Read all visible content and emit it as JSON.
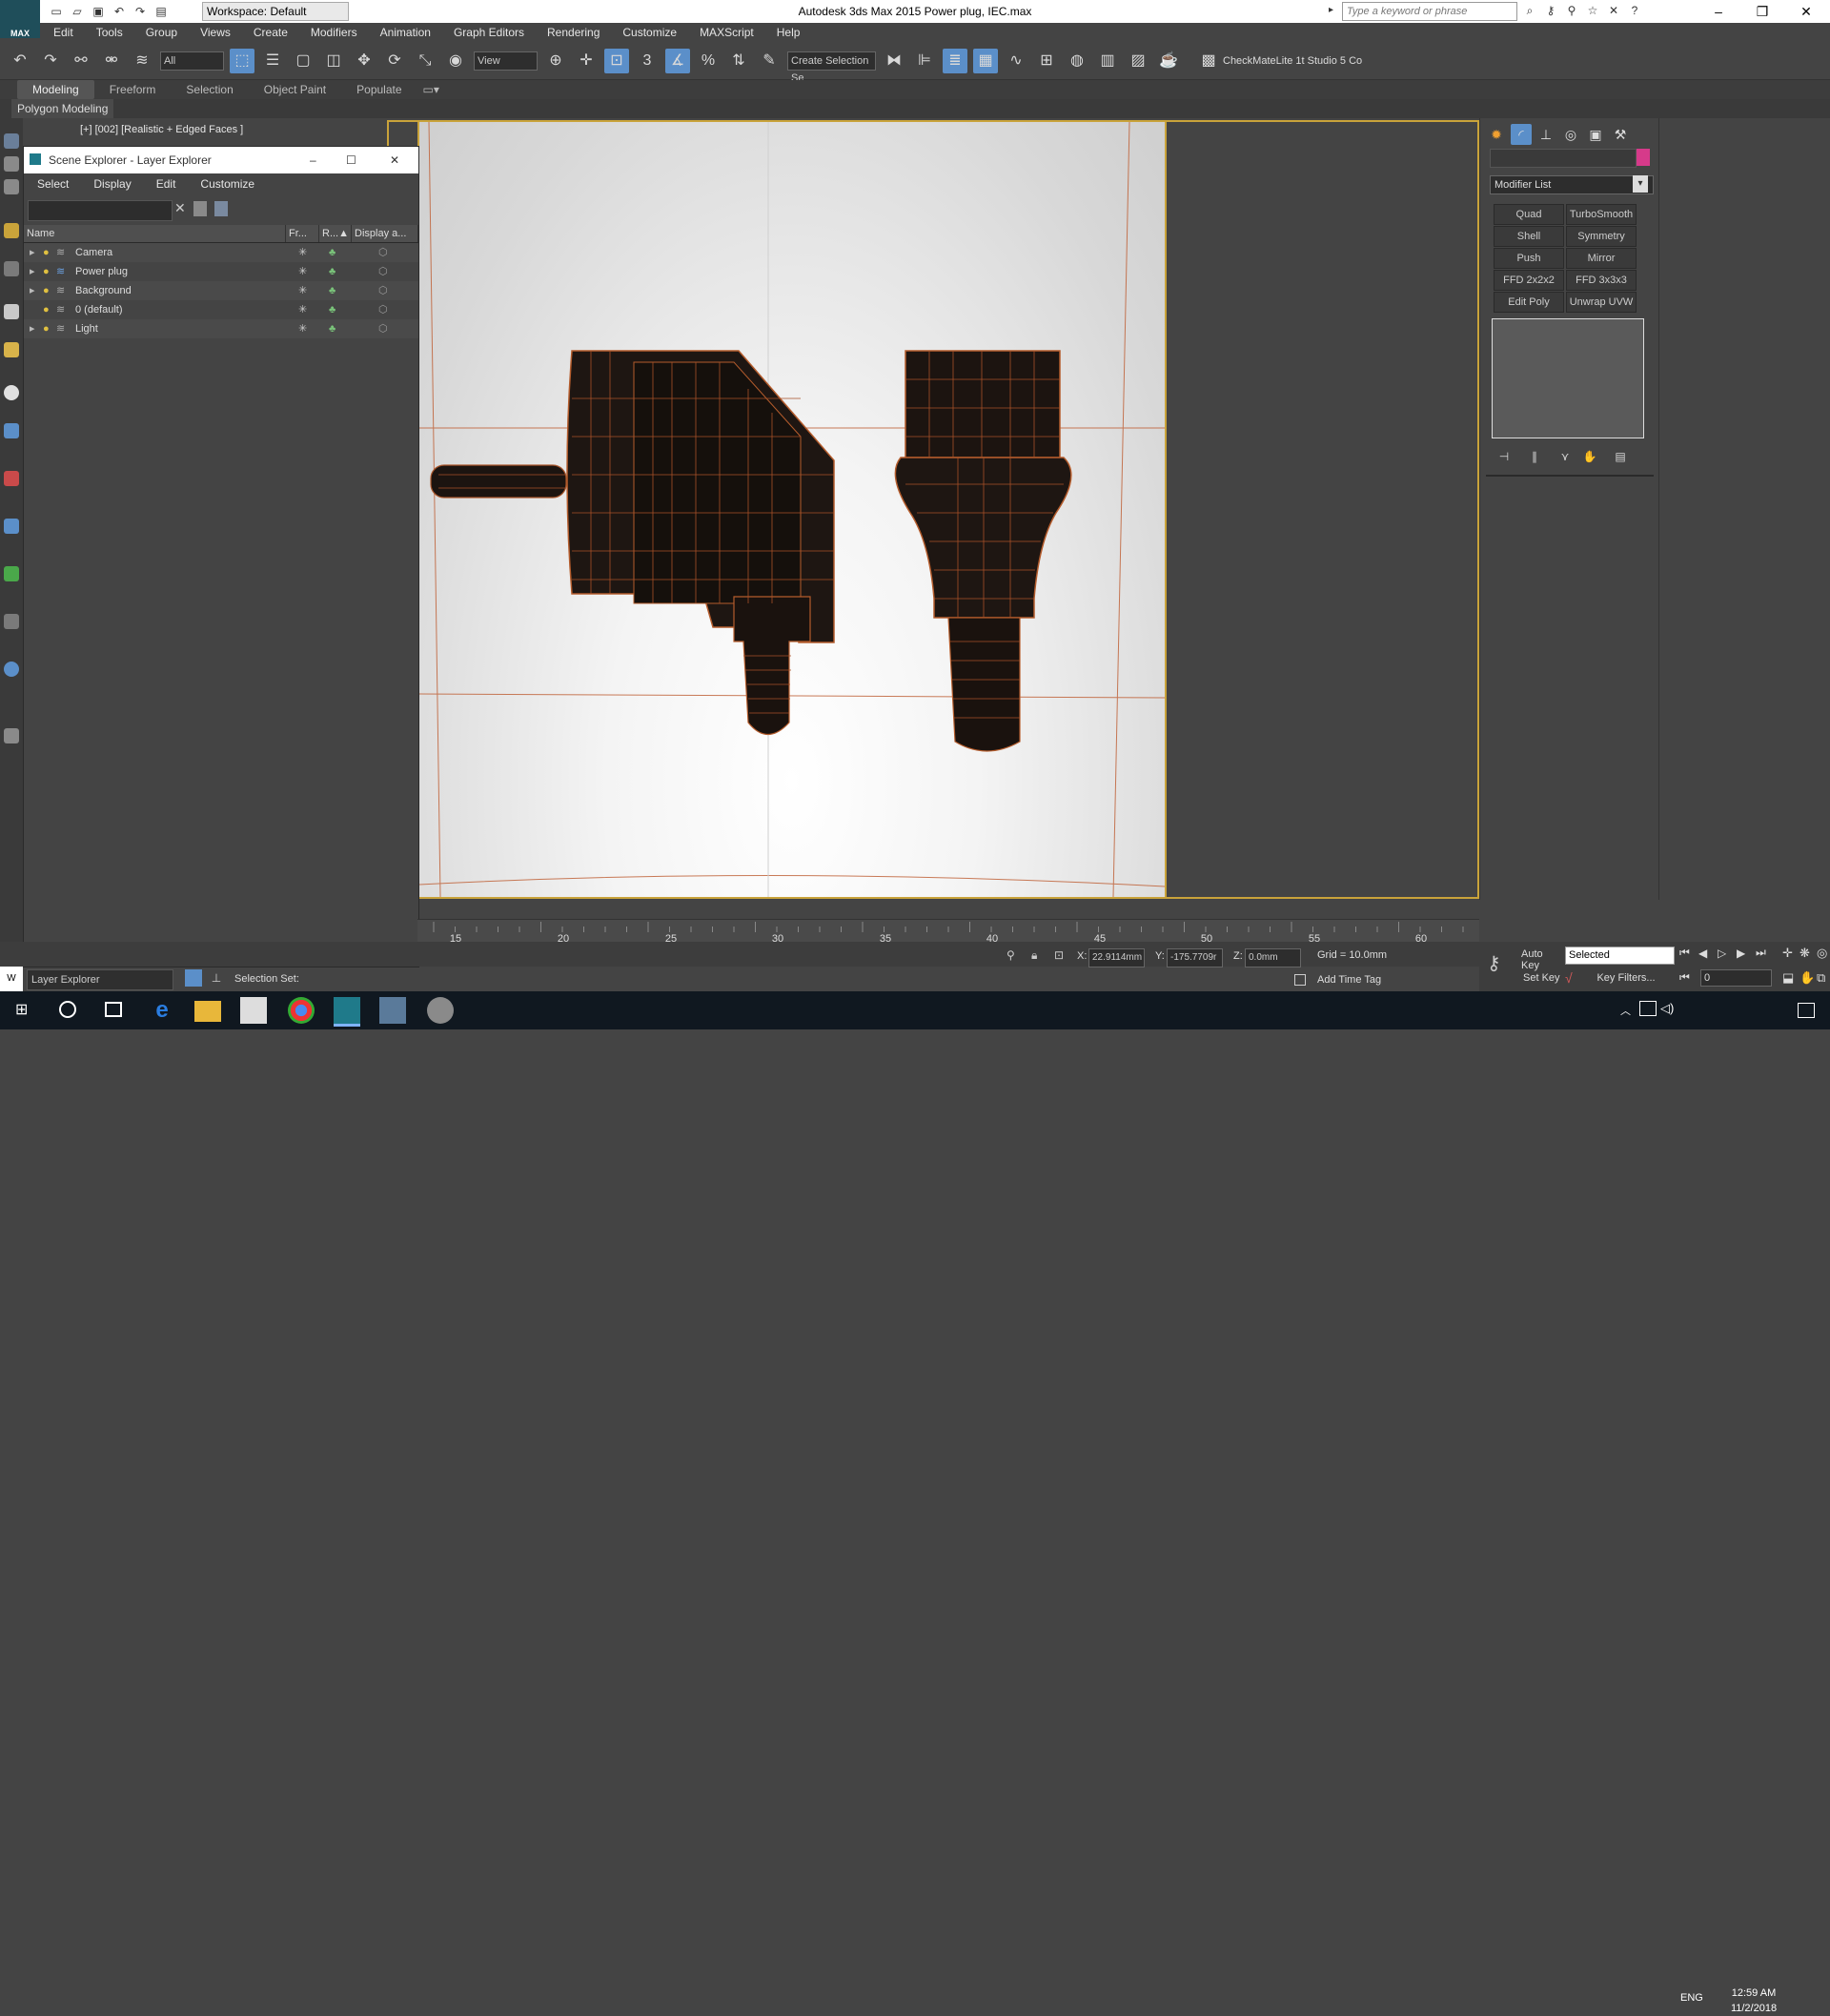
{
  "titlebar": {
    "app_title": "Autodesk 3ds Max  2015      Power plug, IEC.max",
    "workspace": "Workspace: Default",
    "search_placeholder": "Type a keyword or phrase",
    "logo": "MAX"
  },
  "menubar": [
    "Edit",
    "Tools",
    "Group",
    "Views",
    "Create",
    "Modifiers",
    "Animation",
    "Graph Editors",
    "Rendering",
    "Customize",
    "MAXScript",
    "Help"
  ],
  "toolbar": {
    "selection_filter": "All",
    "ref_coord": "View",
    "named_selection": "Create Selection Se",
    "snap_label": "3",
    "plugin_label": "CheckMateLite 1t Studio 5 Co"
  },
  "ribbon": {
    "tabs": [
      "Modeling",
      "Freeform",
      "Selection",
      "Object Paint",
      "Populate"
    ],
    "active_tab": "Modeling",
    "panel_label": "Polygon Modeling"
  },
  "viewport": {
    "label": "[+] [002] [Realistic + Edged Faces ]"
  },
  "scene_explorer": {
    "title": "Scene Explorer - Layer Explorer",
    "menu": [
      "Select",
      "Display",
      "Edit",
      "Customize"
    ],
    "columns": [
      "Name",
      "Fr...",
      "R...▲",
      "Display a..."
    ],
    "layers": [
      {
        "name": "Camera"
      },
      {
        "name": "Power plug"
      },
      {
        "name": "Background"
      },
      {
        "name": "0 (default)"
      },
      {
        "name": "Light"
      }
    ]
  },
  "command_panel": {
    "modifier_list": "Modifier List",
    "modifier_buttons": [
      "Quad Chamfer",
      "TurboSmooth",
      "Shell",
      "Symmetry",
      "Push",
      "Mirror",
      "FFD 2x2x2",
      "FFD 3x3x3",
      "Edit Poly",
      "Unwrap UVW"
    ],
    "object_color": "#d63a8a"
  },
  "timeline": {
    "ticks": [
      "15",
      "20",
      "25",
      "30",
      "35",
      "40",
      "45",
      "50",
      "55",
      "60"
    ]
  },
  "status": {
    "layer_explorer": "Layer Explorer",
    "selection_set": "Selection Set:",
    "x_label": "X:",
    "x_value": "22.9114mm",
    "y_label": "Y:",
    "y_value": "-175.7709r",
    "z_label": "Z:",
    "z_value": "0.0mm",
    "grid": "Grid = 10.0mm",
    "add_time_tag": "Add Time Tag"
  },
  "animation": {
    "auto_key": "Auto Key",
    "set_key": "Set Key",
    "key_mode": "Selected",
    "key_filters": "Key Filters...",
    "frame": "0"
  },
  "taskbar": {
    "language": "ENG",
    "time": "12:59 AM",
    "date": "11/2/2018"
  }
}
